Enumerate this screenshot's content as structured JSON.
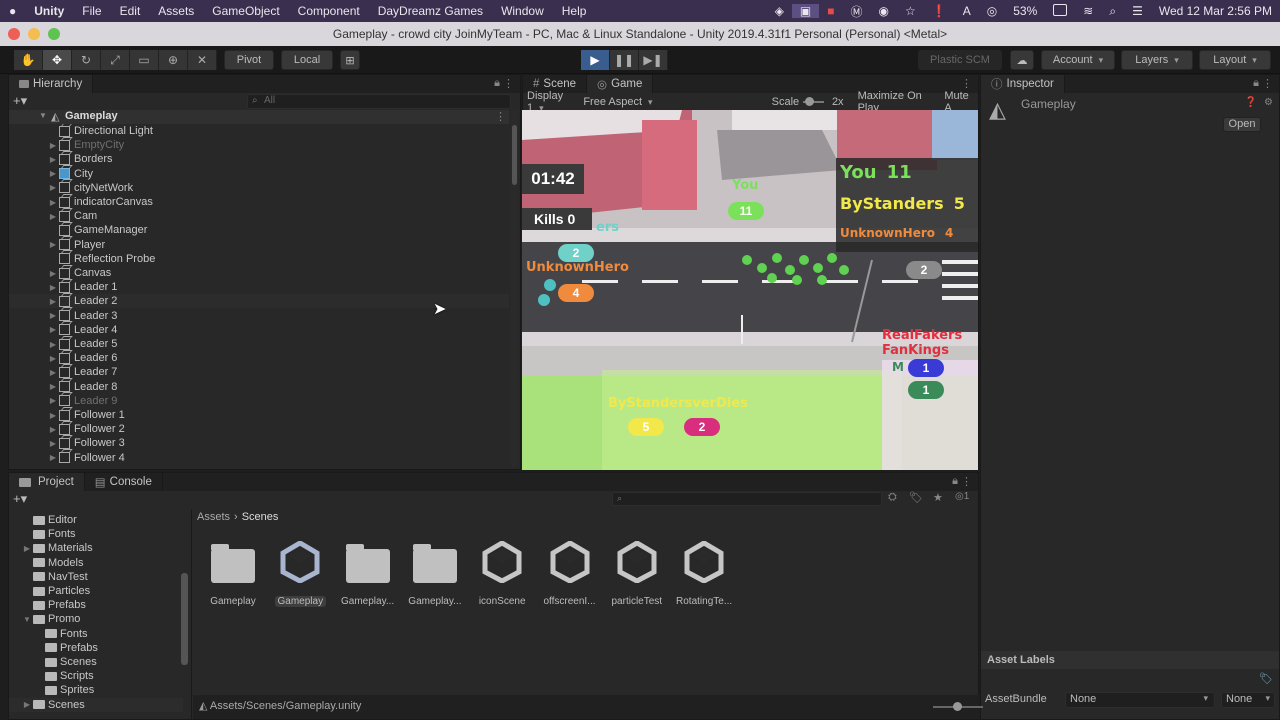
{
  "menubar": {
    "apple": "",
    "app": "Unity",
    "items": [
      "File",
      "Edit",
      "Assets",
      "GameObject",
      "Component",
      "DayDreamz Games",
      "Window",
      "Help"
    ],
    "battery": "53%",
    "datetime": "Wed 12 Mar  2:56 PM"
  },
  "window": {
    "title": "Gameplay - crowd city JoinMyTeam - PC, Mac & Linux Standalone - Unity 2019.4.31f1 Personal (Personal) <Metal>"
  },
  "toolbar": {
    "pivot": "Pivot",
    "local": "Local",
    "plastic": "Plastic SCM",
    "account": "Account",
    "layers": "Layers",
    "layout": "Layout"
  },
  "hierarchy": {
    "tab": "Hierarchy",
    "search_placeholder": "All",
    "scene": "Gameplay",
    "items": [
      {
        "label": "Directional Light",
        "icon": "cube",
        "dim": false,
        "arrow": false
      },
      {
        "label": "EmptyCity",
        "icon": "cube",
        "dim": true,
        "arrow": true
      },
      {
        "label": "Borders",
        "icon": "cube",
        "dim": false,
        "arrow": true
      },
      {
        "label": "City",
        "icon": "cube-blue",
        "dim": false,
        "arrow": true
      },
      {
        "label": "cityNetWork",
        "icon": "cube",
        "dim": false,
        "arrow": true
      },
      {
        "label": "indicatorCanvas",
        "icon": "cube",
        "dim": false,
        "arrow": true
      },
      {
        "label": "Cam",
        "icon": "cube",
        "dim": false,
        "arrow": true
      },
      {
        "label": "GameManager",
        "icon": "cube",
        "dim": false,
        "arrow": false
      },
      {
        "label": "Player",
        "icon": "cube",
        "dim": false,
        "arrow": true
      },
      {
        "label": "Reflection Probe",
        "icon": "cube",
        "dim": false,
        "arrow": false
      },
      {
        "label": "Canvas",
        "icon": "cube",
        "dim": false,
        "arrow": true
      },
      {
        "label": "Leader 1",
        "icon": "cube",
        "dim": false,
        "arrow": true
      },
      {
        "label": "Leader 2",
        "icon": "cube",
        "dim": false,
        "arrow": true
      },
      {
        "label": "Leader 3",
        "icon": "cube",
        "dim": false,
        "arrow": true
      },
      {
        "label": "Leader 4",
        "icon": "cube",
        "dim": false,
        "arrow": true
      },
      {
        "label": "Leader 5",
        "icon": "cube",
        "dim": false,
        "arrow": true
      },
      {
        "label": "Leader 6",
        "icon": "cube",
        "dim": false,
        "arrow": true
      },
      {
        "label": "Leader 7",
        "icon": "cube",
        "dim": false,
        "arrow": true
      },
      {
        "label": "Leader 8",
        "icon": "cube",
        "dim": false,
        "arrow": true
      },
      {
        "label": "Leader 9",
        "icon": "cube",
        "dim": true,
        "arrow": true
      },
      {
        "label": "Follower 1",
        "icon": "cube",
        "dim": false,
        "arrow": true
      },
      {
        "label": "Follower 2",
        "icon": "cube",
        "dim": false,
        "arrow": true
      },
      {
        "label": "Follower 3",
        "icon": "cube",
        "dim": false,
        "arrow": true
      },
      {
        "label": "Follower 4",
        "icon": "cube",
        "dim": false,
        "arrow": true
      }
    ]
  },
  "sceneview": {
    "tabs": [
      "Scene",
      "Game"
    ],
    "display": "Display 1",
    "aspect": "Free Aspect",
    "scale_label": "Scale",
    "scale_value": "2x",
    "maximize": "Maximize On Play",
    "mute": "Mute A"
  },
  "game": {
    "timer": "01:42",
    "kills": "Kills 0",
    "you_label": "You",
    "you_count": "11",
    "scoreboard": [
      {
        "name": "You",
        "value": "11",
        "color": "#7be05a"
      },
      {
        "name": "ByStanders",
        "value": "5",
        "color": "#f2e84a"
      },
      {
        "name": "UnknownHero",
        "value": "4",
        "color": "#f08a3c"
      }
    ],
    "unknownhero_label": "UnknownHero",
    "crowd_left_top": "2",
    "crowd_left_bottom": "4",
    "right_count": "2",
    "bystanders_label": "ByStandersverDies",
    "bystanders_count": "5",
    "pink_count": "2",
    "group_labels": "RealFakers FanKings",
    "blue_count": "1",
    "green_count": "1",
    "side_label": "M",
    "mid_label": "ers"
  },
  "inspector": {
    "tab": "Inspector",
    "name": "Gameplay",
    "open": "Open",
    "asset_labels": "Asset Labels",
    "assetbundle": "AssetBundle",
    "none1": "None",
    "none2": "None"
  },
  "project": {
    "tabs": [
      "Project",
      "Console"
    ],
    "breadcrumb_root": "Assets",
    "breadcrumb_leaf": "Scenes",
    "path": "Assets/Scenes/Gameplay.unity",
    "filter_count": "1",
    "tree": [
      {
        "label": "Editor",
        "indent": 1,
        "arrow": false
      },
      {
        "label": "Fonts",
        "indent": 1,
        "arrow": false
      },
      {
        "label": "Materials",
        "indent": 1,
        "arrow": true
      },
      {
        "label": "Models",
        "indent": 1,
        "arrow": false
      },
      {
        "label": "NavTest",
        "indent": 1,
        "arrow": false
      },
      {
        "label": "Particles",
        "indent": 1,
        "arrow": false
      },
      {
        "label": "Prefabs",
        "indent": 1,
        "arrow": false
      },
      {
        "label": "Promo",
        "indent": 1,
        "arrow": "open"
      },
      {
        "label": "Fonts",
        "indent": 2,
        "arrow": false
      },
      {
        "label": "Prefabs",
        "indent": 2,
        "arrow": false
      },
      {
        "label": "Scenes",
        "indent": 2,
        "arrow": false
      },
      {
        "label": "Scripts",
        "indent": 2,
        "arrow": false
      },
      {
        "label": "Sprites",
        "indent": 2,
        "arrow": false
      },
      {
        "label": "Scenes",
        "indent": 1,
        "arrow": true
      }
    ],
    "assets": [
      {
        "label": "Gameplay",
        "type": "folder"
      },
      {
        "label": "Gameplay",
        "type": "unity",
        "selected": true
      },
      {
        "label": "Gameplay...",
        "type": "folder"
      },
      {
        "label": "Gameplay...",
        "type": "folder"
      },
      {
        "label": "iconScene",
        "type": "unity"
      },
      {
        "label": "offscreenI...",
        "type": "unity"
      },
      {
        "label": "particleTest",
        "type": "unity"
      },
      {
        "label": "RotatingTe...",
        "type": "unity"
      }
    ]
  }
}
